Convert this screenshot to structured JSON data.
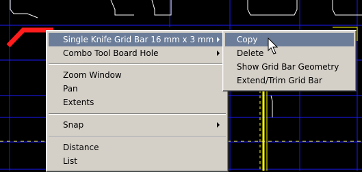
{
  "context_menu": {
    "items": [
      {
        "label": "Single Knife Grid Bar 16 mm x 3 mm",
        "submenu": true,
        "highlighted": true
      },
      {
        "label": "Combo Tool Board Hole",
        "submenu": true
      },
      {
        "label": "Zoom Window"
      },
      {
        "label": "Pan"
      },
      {
        "label": "Extents"
      },
      {
        "label": "Snap",
        "submenu": true
      },
      {
        "label": "Distance"
      },
      {
        "label": "List"
      }
    ]
  },
  "submenu": {
    "items": [
      {
        "label": "Copy",
        "highlighted": true
      },
      {
        "label": "Delete"
      },
      {
        "label": "Show Grid Bar Geometry"
      },
      {
        "label": "Extend/Trim Grid Bar"
      }
    ]
  },
  "colors": {
    "canvas_background": "#000000",
    "highlight": "#6b7d98",
    "menu_face": "#d4d0c8",
    "cad_red": "#ff1c1c",
    "cad_yellow": "#ffff00",
    "cad_blue_grid": "#1a1aff",
    "cad_white": "#ffffff"
  },
  "icons": {
    "cursor": "arrow-pointer-icon",
    "submenu_arrow": "chevron-right-icon"
  }
}
